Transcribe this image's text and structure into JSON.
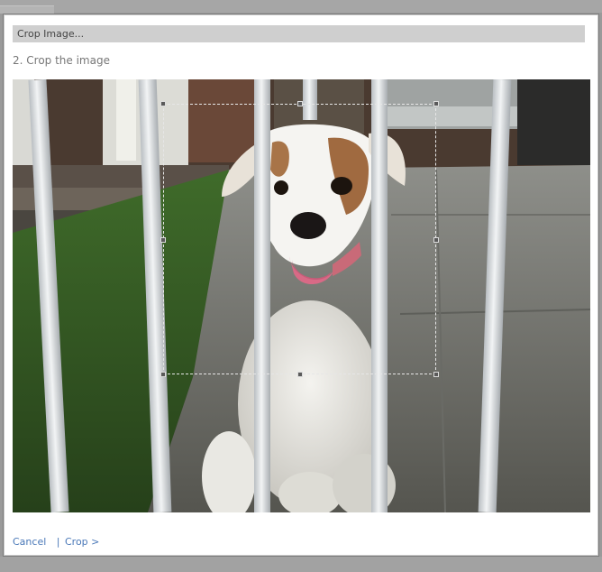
{
  "dialog": {
    "title": "Crop Image...",
    "step_heading": "2. Crop the image"
  },
  "image": {
    "subject": "photo-dog-behind-fence"
  },
  "footer": {
    "cancel_label": "Cancel",
    "separator": "|",
    "crop_label": "Crop >"
  },
  "colors": {
    "title_bar_bg": "#cfcfcf",
    "link": "#4a78b8",
    "dialog_border": "#7c7c7c"
  }
}
